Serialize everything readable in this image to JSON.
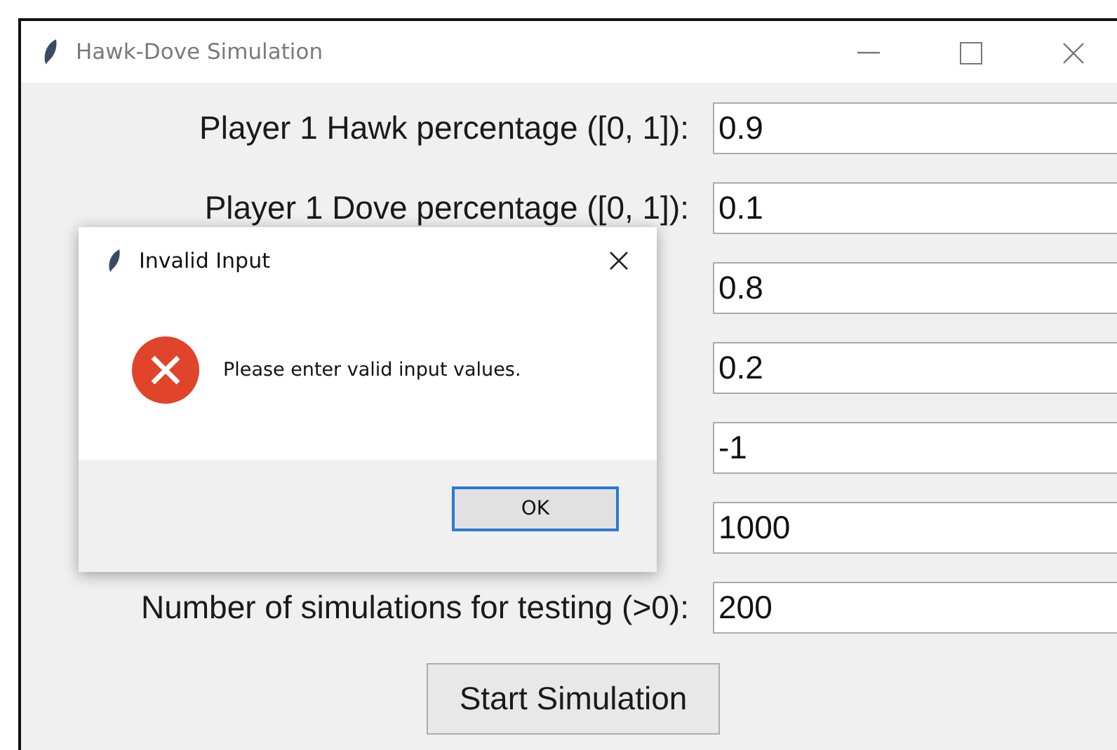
{
  "window": {
    "title": "Hawk-Dove Simulation"
  },
  "fields": [
    {
      "label": "Player 1 Hawk percentage ([0, 1]):",
      "value": "0.9"
    },
    {
      "label": "Player 1 Dove percentage ([0, 1]):",
      "value": "0.1"
    },
    {
      "value": "0.8"
    },
    {
      "value": "0.2"
    },
    {
      "value": "-1"
    },
    {
      "value": "1000"
    },
    {
      "label": "Number of simulations for testing (>0):",
      "value": "200"
    }
  ],
  "start_button": "Start Simulation",
  "dialog": {
    "title": "Invalid Input",
    "kind": "error",
    "message": "Please enter valid input values.",
    "button": "OK"
  }
}
